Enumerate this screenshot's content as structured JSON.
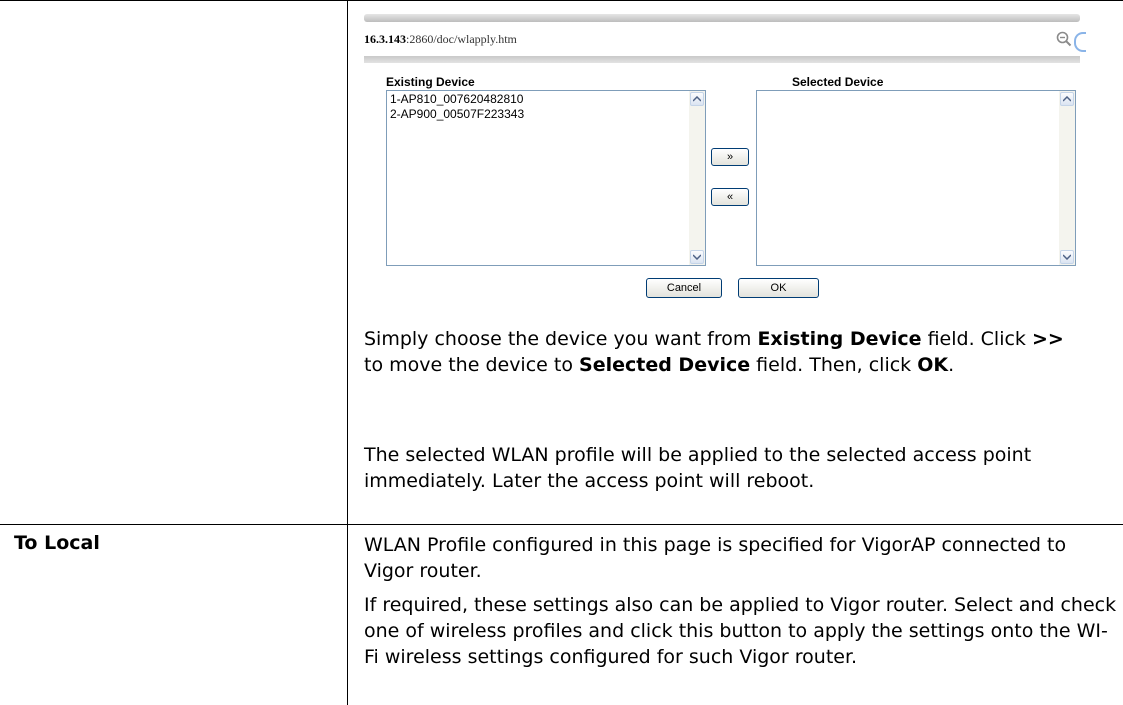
{
  "browser": {
    "url_bold": "16.3.143",
    "url_rest": ":2860/doc/wlapply.htm"
  },
  "dialog": {
    "existing_label": "Existing Device",
    "selected_label": "Selected Device",
    "existing_items": [
      "1-AP810_007620482810",
      "2-AP900_00507F223343"
    ],
    "move_right_label": "»",
    "move_left_label": "«",
    "cancel_label": "Cancel",
    "ok_label": "OK"
  },
  "row1": {
    "p1_a": "Simply choose the device you want from ",
    "p1_b": "Existing Device",
    "p1_c": " field. Click ",
    "p1_d": ">>",
    "p1_e": " to move the device to ",
    "p1_f": "Selected Device",
    "p1_g": " field. Then, click ",
    "p1_h": "OK",
    "p1_i": ".",
    "p2": "The selected WLAN profile will be applied to the selected access point immediately. Later the access point will reboot."
  },
  "row2": {
    "term": "To Local",
    "p1": "WLAN Profile configured in this page is specified for VigorAP connected to Vigor router.",
    "p2": "If required, these settings also can be applied to Vigor router. Select and check one of wireless profiles and click this button to apply the settings onto the WI-Fi wireless settings configured for such Vigor router."
  }
}
